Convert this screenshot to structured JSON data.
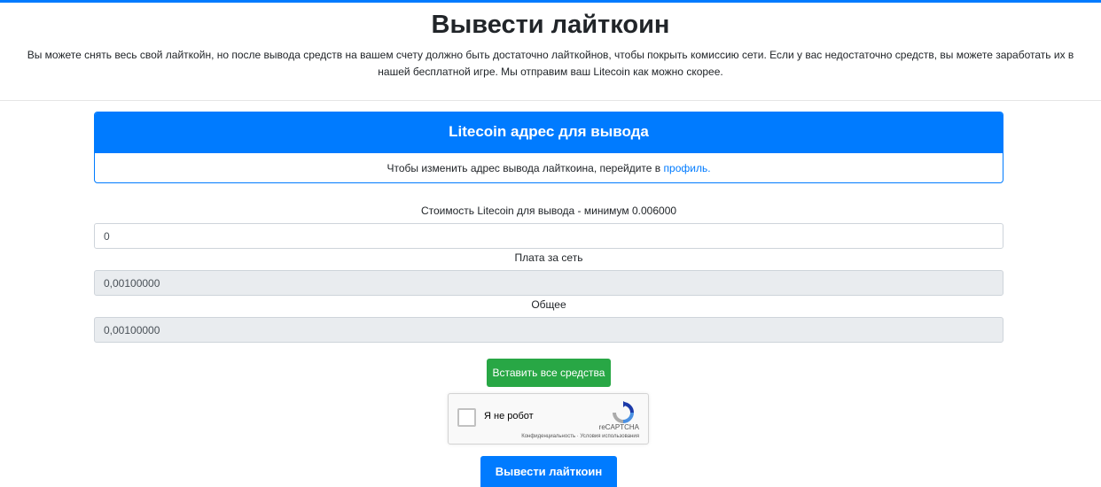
{
  "page": {
    "title": "Вывести лайткоин",
    "description": "Вы можете снять весь свой лайткойн, но после вывода средств на вашем счету должно быть достаточно лайткойнов, чтобы покрыть комиссию сети. Если у вас недостаточно средств, вы можете заработать их в нашей бесплатной игре. Мы отправим ваш Litecoin как можно скорее."
  },
  "address_card": {
    "header": "Litecoin адрес для вывода",
    "text": "Чтобы изменить адрес вывода лайткоина, перейдите в",
    "link": "профиль."
  },
  "form": {
    "amount_label": "Стоимость Litecoin для вывода - минимум 0.006000",
    "amount_value": "0",
    "fee_label": "Плата за сеть",
    "fee_value": "0,00100000",
    "total_label": "Общее",
    "total_value": "0,00100000",
    "insert_all_button": "Вставить все средства",
    "submit_button": "Вывести лайткоин"
  },
  "captcha": {
    "checkbox_label": "Я не робот",
    "brand": "reCAPTCHA",
    "links": "Конфиденциальность · Условия использования"
  },
  "colors": {
    "primary": "#007bff",
    "success": "#28a745",
    "readonly_bg": "#e9ecef"
  }
}
